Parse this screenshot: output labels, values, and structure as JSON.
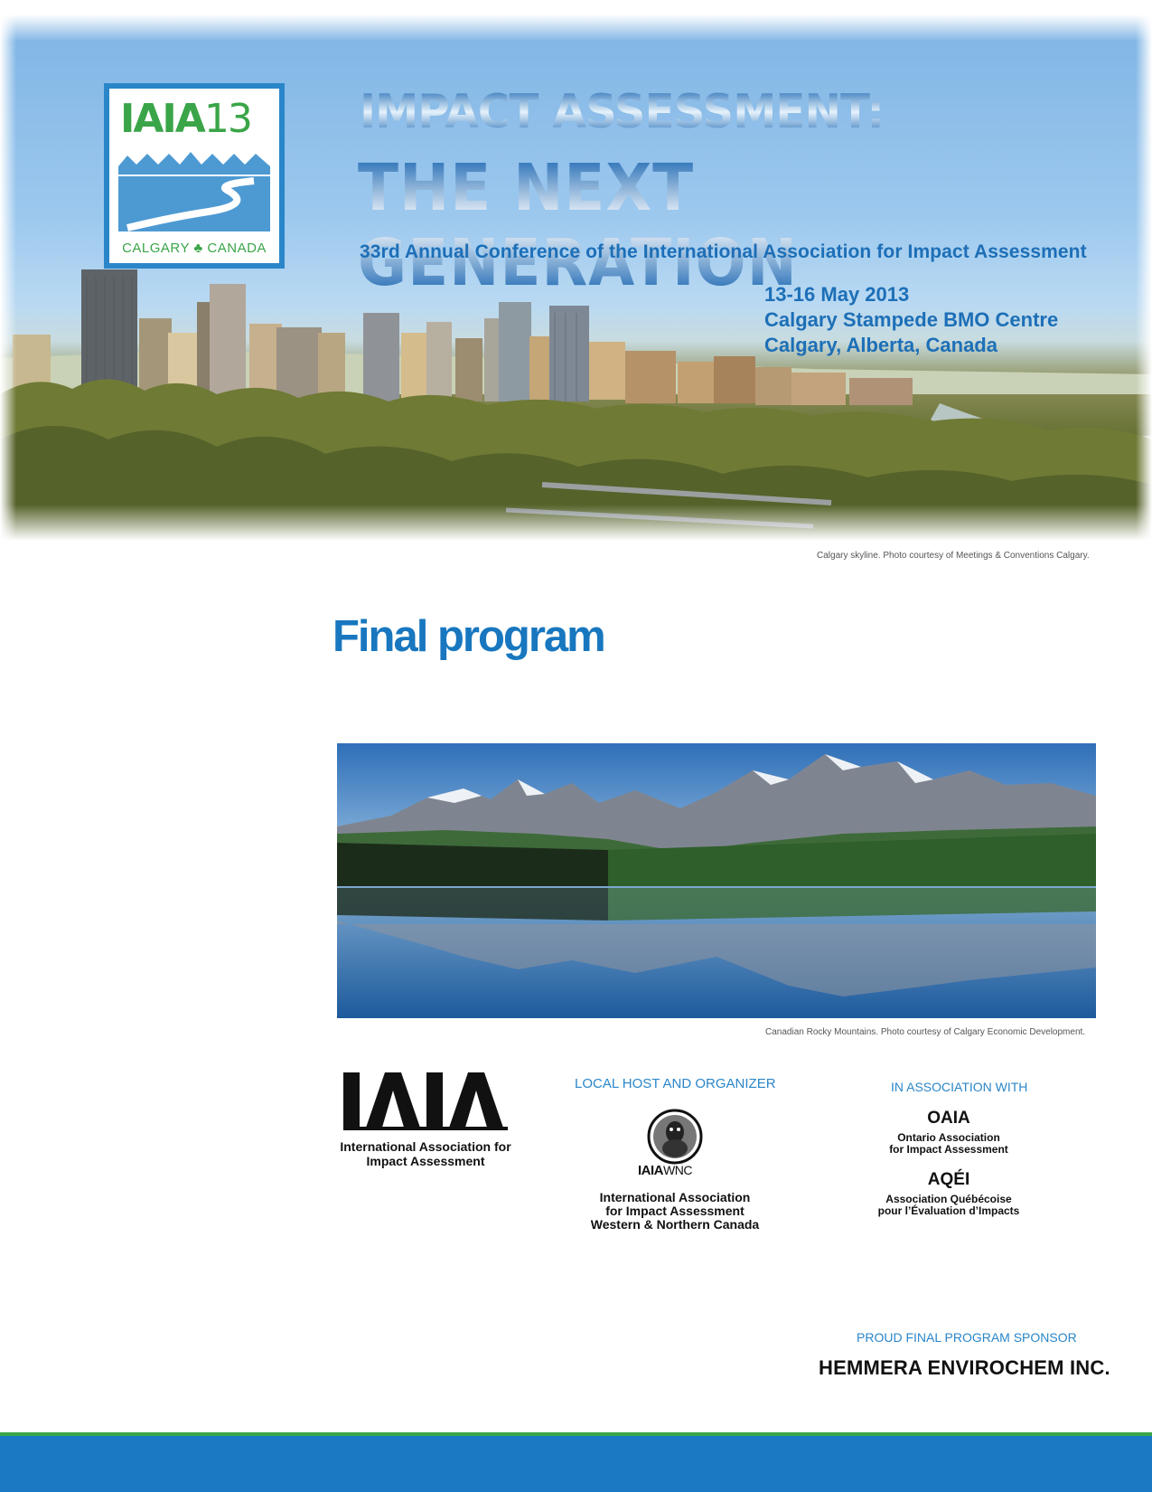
{
  "logo": {
    "title": "IAIA",
    "number": "13",
    "city": "CALGARY ♣ CANADA"
  },
  "conference": {
    "title_line1": "IMPACT ASSESSMENT:",
    "title_line2": "THE NEXT GENERATION",
    "subtitle": "33rd Annual Conference of the International Association for Impact Assessment",
    "dates": "13-16 May 2013",
    "venue": "Calgary Stampede BMO Centre",
    "location": "Calgary, Alberta, Canada"
  },
  "captions": {
    "skyline": "Calgary skyline. Photo courtesy of Meetings & Conventions Calgary.",
    "mountains": "Canadian Rocky Mountains. Photo courtesy of Calgary Economic Development."
  },
  "document_title": "Final program",
  "organizers": {
    "iaia": {
      "logo_text": "IAIA",
      "name_line1": "International Association for",
      "name_line2": "Impact Assessment"
    },
    "local_host": {
      "label": "LOCAL HOST AND ORGANIZER",
      "logo_text": "IAIA",
      "logo_suffix": "WNC",
      "name_line1": "International Association",
      "name_line2": "for Impact Assessment",
      "name_line3": "Western & Northern Canada"
    },
    "association": {
      "label": "IN ASSOCIATION WITH",
      "oaia_abbr": "OAIA",
      "oaia_line1": "Ontario Association",
      "oaia_line2": "for Impact Assessment",
      "aqei_abbr": "AQÉI",
      "aqei_line1": "Association Québécoise",
      "aqei_line2": "pour l’Évaluation d’Impacts"
    }
  },
  "sponsor": {
    "label": "PROUD FINAL PROGRAM SPONSOR",
    "name": "HEMMERA ENVIROCHEM INC."
  },
  "colors": {
    "brand_blue": "#1877bf",
    "brand_green": "#3aa548",
    "footer_blue": "#1a79c2"
  }
}
